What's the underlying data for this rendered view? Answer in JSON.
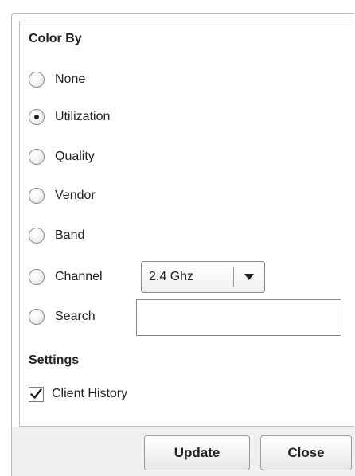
{
  "color_by": {
    "title": "Color By",
    "options": [
      {
        "label": "None",
        "selected": false
      },
      {
        "label": "Utilization",
        "selected": true
      },
      {
        "label": "Quality",
        "selected": false
      },
      {
        "label": "Vendor",
        "selected": false
      },
      {
        "label": "Band",
        "selected": false
      },
      {
        "label": "Channel",
        "selected": false
      },
      {
        "label": "Search",
        "selected": false
      }
    ],
    "channel_select": {
      "value": "2.4 Ghz",
      "icon": "chevron-down-icon"
    },
    "search_input": {
      "value": ""
    }
  },
  "settings": {
    "title": "Settings",
    "client_history": {
      "label": "Client History",
      "checked": true
    }
  },
  "buttons": {
    "update_label": "Update",
    "close_label": "Close"
  }
}
